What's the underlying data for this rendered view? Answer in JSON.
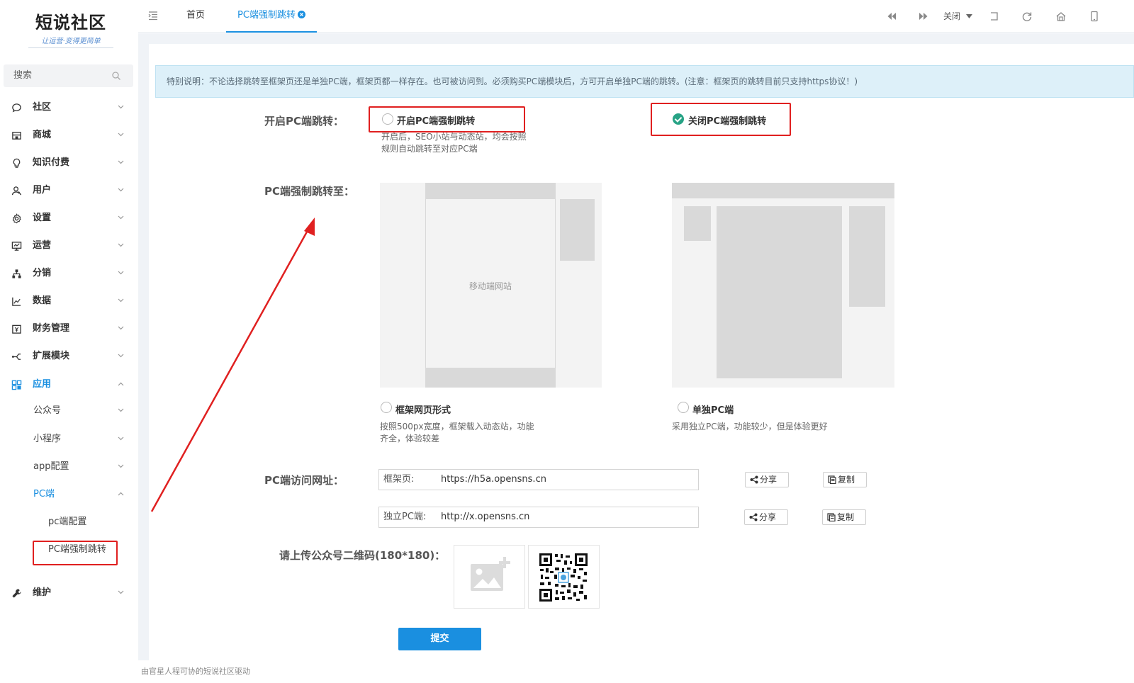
{
  "brand": {
    "title": "短说社区",
    "subtitle": "让运营·变得更简单"
  },
  "search": {
    "placeholder": "搜索"
  },
  "sidebar": {
    "items": [
      {
        "label": "社区",
        "icon": "chat-icon"
      },
      {
        "label": "商城",
        "icon": "shop-icon"
      },
      {
        "label": "知识付费",
        "icon": "lightbulb-icon"
      },
      {
        "label": "用户",
        "icon": "user-icon"
      },
      {
        "label": "设置",
        "icon": "gear-icon"
      },
      {
        "label": "运营",
        "icon": "monitor-icon"
      },
      {
        "label": "分销",
        "icon": "hierarchy-icon"
      },
      {
        "label": "数据",
        "icon": "line-chart-icon"
      },
      {
        "label": "财务管理",
        "icon": "finance-icon"
      },
      {
        "label": "扩展模块",
        "icon": "extension-icon"
      },
      {
        "label": "应用",
        "icon": "apps-icon"
      },
      {
        "label": "维护",
        "icon": "wrench-icon"
      }
    ],
    "app_children": [
      {
        "label": "公众号"
      },
      {
        "label": "小程序"
      },
      {
        "label": "app配置"
      },
      {
        "label": "PC端"
      }
    ],
    "pc_children": [
      {
        "label": "pc端配置"
      },
      {
        "label": "PC端强制跳转"
      }
    ]
  },
  "topbar": {
    "tabs": [
      {
        "label": "首页"
      },
      {
        "label": "PC端强制跳转"
      }
    ],
    "close_menu": "关闭",
    "icons": [
      "menu-toggle-icon",
      "prev-icon",
      "next-icon",
      "close-dropdown-icon",
      "exit-fullscreen-icon",
      "refresh-icon",
      "home-icon",
      "mobile-icon"
    ]
  },
  "notice": "特别说明：不论选择跳转至框架页还是单独PC端，框架页都一样存在。也可被访问到。必须购买PC端模块后，方可开启单独PC端的跳转。(注意：框架页的跳转目前只支持https协议！)",
  "form": {
    "enable_label": "开启PC端跳转：",
    "enable_option": "开启PC端强制跳转",
    "disable_option": "关闭PC端强制跳转",
    "enable_help": "开启后，SEO小站与动态站，均会按照规则自动跳转至对应PC端",
    "enabled": false,
    "target_label": "PC端强制跳转至：",
    "preview_mobile_text": "移动端网站",
    "frame_option": "框架网页形式",
    "frame_help": "按照500px宽度，框架载入动态站，功能齐全，体验较差",
    "standalone_option": "单独PC端",
    "standalone_help": "采用独立PC端，功能较少，但是体验更好",
    "url_label": "PC端访问网址：",
    "urls": [
      {
        "prefix": "框架页:",
        "value": "https://h5a.opensns.cn"
      },
      {
        "prefix": "独立PC端:",
        "value": "http://x.opensns.cn"
      }
    ],
    "share_label": "分享",
    "copy_label": "复制",
    "qr_label": "请上传公众号二维码(180*180)：",
    "submit_label": "提交"
  },
  "footer_text": "由官星人程可协的短说社区驱动"
}
